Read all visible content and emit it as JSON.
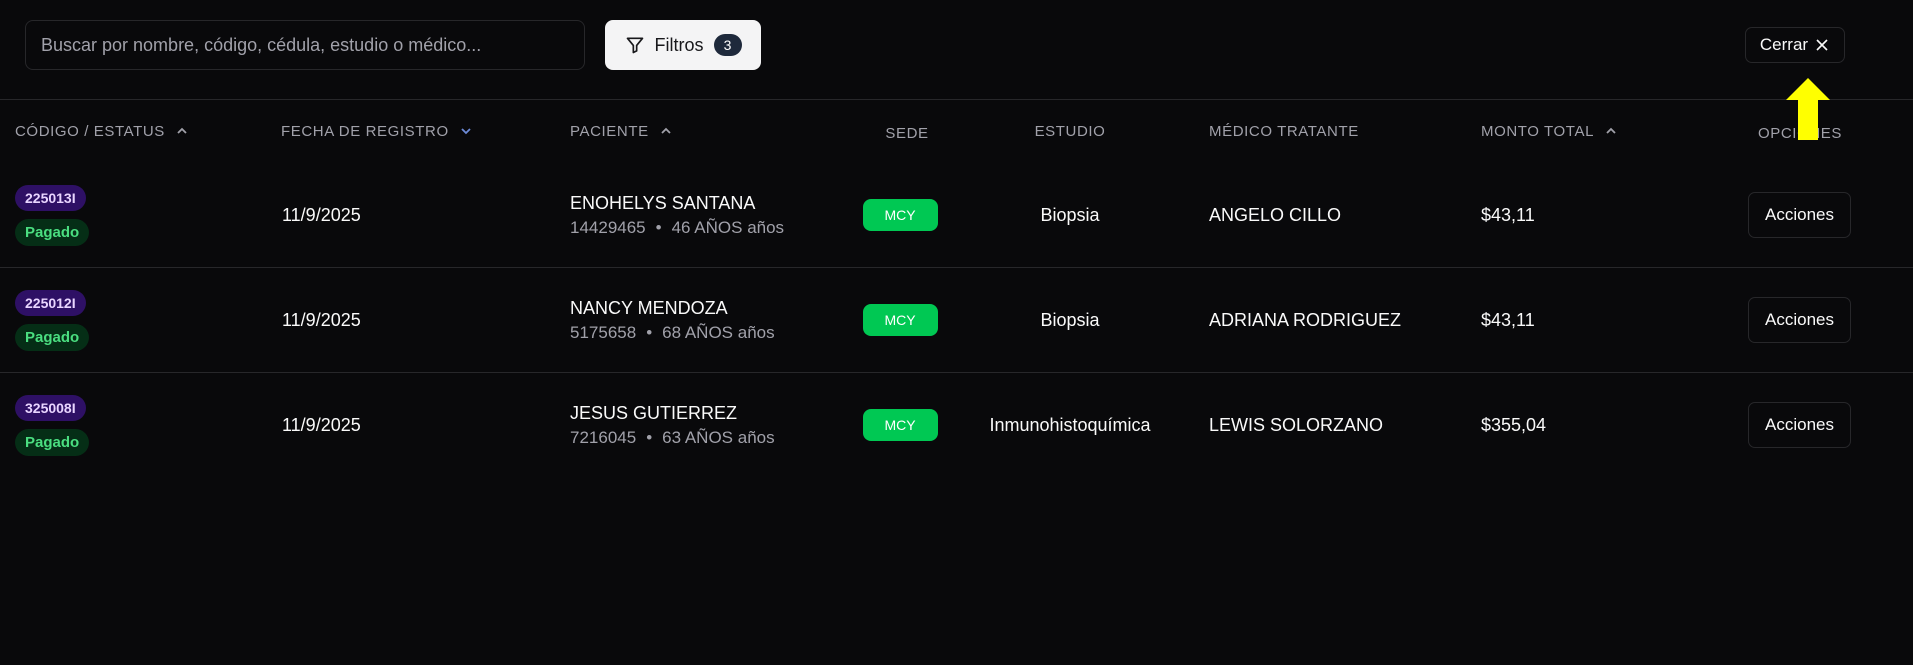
{
  "toolbar": {
    "search_placeholder": "Buscar por nombre, código, cédula, estudio o médico...",
    "filters_label": "Filtros",
    "filters_count": "3",
    "close_label": "Cerrar"
  },
  "table": {
    "headers": {
      "code_status": "CÓDIGO / ESTATUS",
      "date": "FECHA DE REGISTRO",
      "patient": "PACIENTE",
      "site": "SEDE",
      "study": "ESTUDIO",
      "doctor": "MÉDICO TRATANTE",
      "amount": "MONTO TOTAL",
      "options": "OPCIONES"
    },
    "rows": [
      {
        "code": "225013I",
        "status": "Pagado",
        "date": "11/9/2025",
        "patient_name": "ENOHELYS SANTANA",
        "patient_id": "14429465",
        "patient_age": "46 AÑOS años",
        "site": "MCY",
        "study": "Biopsia",
        "doctor": "ANGELO CILLO",
        "amount": "$43,11",
        "action": "Acciones"
      },
      {
        "code": "225012I",
        "status": "Pagado",
        "date": "11/9/2025",
        "patient_name": "NANCY MENDOZA",
        "patient_id": "5175658",
        "patient_age": "68 AÑOS años",
        "site": "MCY",
        "study": "Biopsia",
        "doctor": "ADRIANA RODRIGUEZ",
        "amount": "$43,11",
        "action": "Acciones"
      },
      {
        "code": "325008I",
        "status": "Pagado",
        "date": "11/9/2025",
        "patient_name": "JESUS GUTIERREZ",
        "patient_id": "7216045",
        "patient_age": "63 AÑOS años",
        "site": "MCY",
        "study": "Inmunohistoquímica",
        "doctor": "LEWIS SOLORZANO",
        "amount": "$355,04",
        "action": "Acciones"
      }
    ]
  },
  "colors": {
    "background": "#09090b",
    "code_badge": "#2e1065",
    "status_badge": "#052e16",
    "site_badge": "#00c853",
    "pointer_arrow": "#ffff00"
  }
}
